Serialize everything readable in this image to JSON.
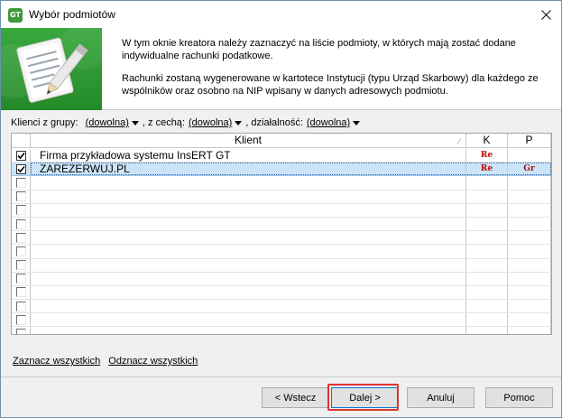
{
  "window": {
    "title": "Wybór podmiotów",
    "app_icon_text": "GT"
  },
  "header": {
    "line1": "W tym oknie kreatora należy zaznaczyć na liście podmioty, w których mają zostać dodane indywidualne rachunki podatkowe.",
    "line2": "Rachunki zostaną wygenerowane w kartotece Instytucji (typu Urząd Skarbowy) dla każdego ze wspólników oraz osobno na NIP wpisany w danych adresowych podmiotu."
  },
  "filters": {
    "group_label": "Klienci z grupy:",
    "group_value": "(dowolna)",
    "feature_label": ", z cechą:",
    "feature_value": "(dowolna)",
    "activity_label": ", działalność:",
    "activity_value": "(dowolna)"
  },
  "grid": {
    "columns": {
      "name": "Klient",
      "k": "K",
      "p": "P"
    },
    "rows": [
      {
        "checked": true,
        "name": "Firma przykładowa systemu InsERT GT",
        "k": "Re",
        "p": ""
      },
      {
        "checked": true,
        "name": "ZAREZERWUJ.PL",
        "k": "Re",
        "p": "Gr"
      },
      {
        "checked": false,
        "name": "",
        "k": "",
        "p": ""
      },
      {
        "checked": false,
        "name": "",
        "k": "",
        "p": ""
      },
      {
        "checked": false,
        "name": "",
        "k": "",
        "p": ""
      },
      {
        "checked": false,
        "name": "",
        "k": "",
        "p": ""
      },
      {
        "checked": false,
        "name": "",
        "k": "",
        "p": ""
      },
      {
        "checked": false,
        "name": "",
        "k": "",
        "p": ""
      },
      {
        "checked": false,
        "name": "",
        "k": "",
        "p": ""
      },
      {
        "checked": false,
        "name": "",
        "k": "",
        "p": ""
      },
      {
        "checked": false,
        "name": "",
        "k": "",
        "p": ""
      },
      {
        "checked": false,
        "name": "",
        "k": "",
        "p": ""
      },
      {
        "checked": false,
        "name": "",
        "k": "",
        "p": ""
      },
      {
        "checked": false,
        "name": "",
        "k": "",
        "p": ""
      }
    ]
  },
  "links": {
    "select_all": "Zaznacz wszystkich",
    "deselect_all": "Odznacz wszystkich"
  },
  "buttons": {
    "back": "< Wstecz",
    "next": "Dalej >",
    "cancel": "Anuluj",
    "help": "Pomoc"
  },
  "colors": {
    "accent_green": "#2f9833",
    "tag_red": "#c00000",
    "selection": "#cce4f7",
    "highlight_red": "#e0312f"
  }
}
